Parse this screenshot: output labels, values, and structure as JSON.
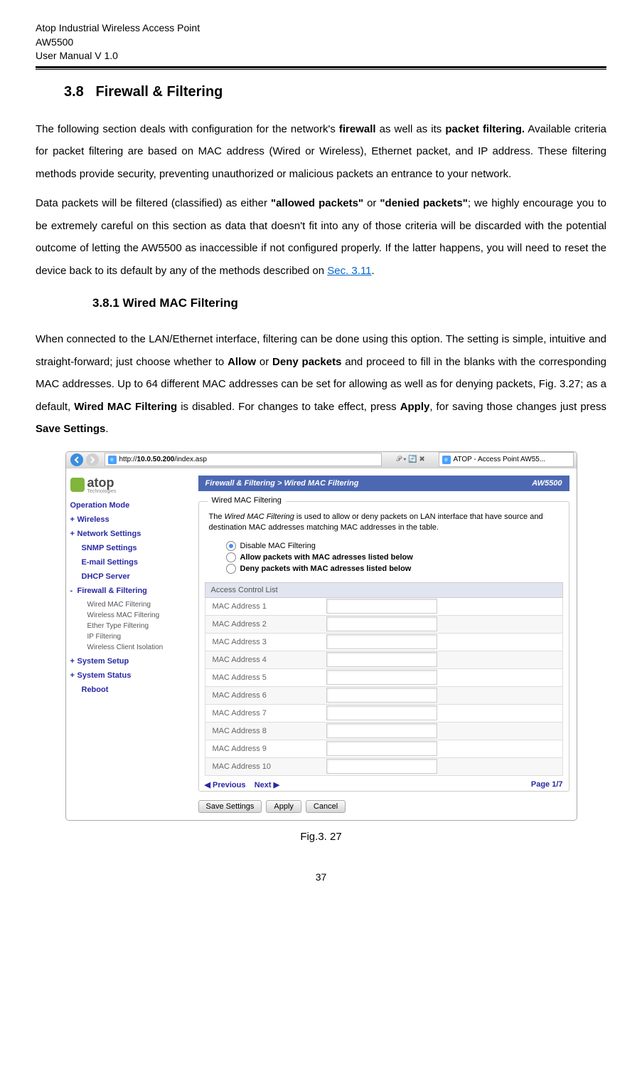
{
  "header": {
    "line1": "Atop Industrial Wireless Access Point",
    "line2": "AW5500",
    "line3": "User Manual V 1.0"
  },
  "section": {
    "num": "3.8",
    "title": "Firewall & Filtering"
  },
  "para1_parts": {
    "t1": "The following section deals with configuration for the network's ",
    "b1": "firewall",
    "t2": " as well as its ",
    "b2": "packet filtering.",
    "t3": " Available criteria for packet filtering are based on MAC address (Wired or Wireless), Ethernet packet, and IP address. These filtering methods provide security, preventing unauthorized or malicious packets an entrance to your network."
  },
  "para2_parts": {
    "t1": "Data packets will be filtered (classified) as either ",
    "b1": "\"allowed packets\"",
    "t2": " or ",
    "b2": "\"denied packets\"",
    "t3": "; we highly encourage you to be extremely careful on this section as data that doesn't fit into any of those criteria will be discarded with the potential outcome of letting the AW5500 as inaccessible if not configured properly. If the latter happens, you will need to reset the device back to its default by any of the methods described on ",
    "link": "Sec. 3.11",
    "t4": "."
  },
  "subsection": {
    "num": "3.8.1",
    "title": "Wired MAC Filtering"
  },
  "para3_parts": {
    "t1": "When connected to the LAN/Ethernet interface, filtering can be done using this option. The setting is simple, intuitive and straight-forward; just choose whether to ",
    "b1": "Allow",
    "t2": " or ",
    "b2": "Deny packets",
    "t3": " and proceed to fill in the blanks with the corresponding MAC addresses. Up to 64 different MAC addresses can be set for allowing as well as for denying packets, Fig. 3.27; as a default, ",
    "b3": "Wired MAC Filtering",
    "t4": " is disabled. For changes to take effect, press ",
    "b4": "Apply",
    "t5": ", for saving those changes just press ",
    "b5": "Save Settings",
    "t6": "."
  },
  "browser": {
    "url_prefix": "http://",
    "url_host": "10.0.50.200",
    "url_path": "/index.asp",
    "search_hint": "𝒫 ▾  🔄 ✖",
    "tab_label": "ATOP - Access Point AW55..."
  },
  "logo": {
    "name": "atop",
    "sub": "Technologies"
  },
  "nav": {
    "op_mode": "Operation Mode",
    "wireless": "Wireless",
    "net": "Network Settings",
    "snmp": "SNMP Settings",
    "email": "E-mail Settings",
    "dhcp": "DHCP Server",
    "fw": "Firewall & Filtering",
    "sub1": "Wired MAC Filtering",
    "sub2": "Wireless MAC Filtering",
    "sub3": "Ether Type Filtering",
    "sub4": "IP Filtering",
    "sub5": "Wireless Client Isolation",
    "setup": "System Setup",
    "status": "System Status",
    "reboot": "Reboot"
  },
  "crumb": {
    "left": "Firewall & Filtering > Wired MAC Filtering",
    "right": "AW5500"
  },
  "panel_title": "Wired MAC Filtering",
  "desc": {
    "t1": "The ",
    "ital": "Wired MAC Filtering",
    "t2": " is used to allow or deny packets on LAN interface that have source and destination MAC addresses matching MAC addresses in the table."
  },
  "radios": {
    "r1": "Disable MAC Filtering",
    "r2": "Allow packets with MAC adresses listed below",
    "r3": "Deny packets with MAC adresses listed below"
  },
  "acl_head": "Access Control List",
  "rows": [
    "MAC Address 1",
    "MAC Address 2",
    "MAC Address 3",
    "MAC Address 4",
    "MAC Address 5",
    "MAC Address 6",
    "MAC Address 7",
    "MAC Address 8",
    "MAC Address 9",
    "MAC Address 10"
  ],
  "pager": {
    "prev": "◀ Previous",
    "next": "Next ▶",
    "page": "Page 1/7"
  },
  "buttons": {
    "save": "Save Settings",
    "apply": "Apply",
    "cancel": "Cancel"
  },
  "fig_caption": "Fig.3. 27",
  "page_num": "37"
}
